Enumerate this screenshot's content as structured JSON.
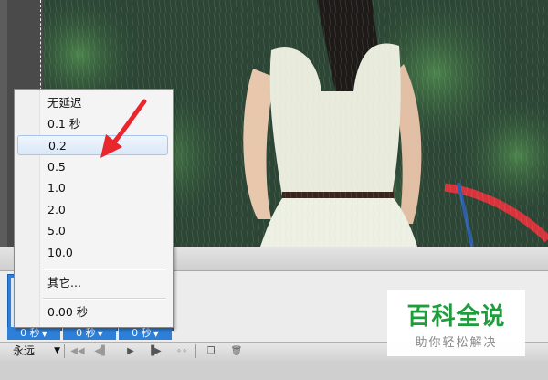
{
  "colors": {
    "menu_bg": "#f4f4f4",
    "menu_selected": "#dbe8f8",
    "frame_selected": "#2d7fd8",
    "annotation_arrow": "#e8262b",
    "watermark_green": "#1f9d3c",
    "watermark_gray": "#8a8a8a"
  },
  "delay_menu": {
    "items": [
      {
        "label": "无延迟",
        "selected": false
      },
      {
        "label": "0.1 秒",
        "selected": false
      },
      {
        "label": "0.2",
        "selected": true
      },
      {
        "label": "0.5",
        "selected": false
      },
      {
        "label": "1.0",
        "selected": false
      },
      {
        "label": "2.0",
        "selected": false
      },
      {
        "label": "5.0",
        "selected": false
      },
      {
        "label": "10.0",
        "selected": false
      }
    ],
    "other_label": "其它...",
    "current_label": "0.00 秒"
  },
  "frames": [
    {
      "delay": "0 秒"
    },
    {
      "delay": "0 秒"
    },
    {
      "delay": "0 秒"
    }
  ],
  "toolbar": {
    "loop_value": "永远",
    "icons": [
      "first-frame-icon",
      "prev-frame-icon",
      "play-icon",
      "next-frame-icon",
      "tween-icon",
      "new-frame-icon",
      "delete-frame-icon"
    ]
  },
  "watermark": {
    "title": "百科全说",
    "subtitle": "助你轻松解决"
  }
}
